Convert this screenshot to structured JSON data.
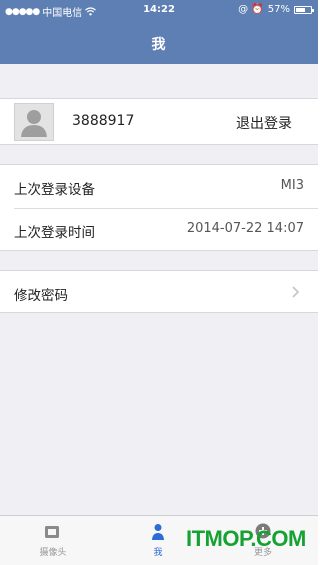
{
  "status_bar": {
    "signal": "●●●●●",
    "carrier": "中国电信",
    "wifi_icon": "wifi-icon",
    "time": "14:22",
    "indicators": "@ ⏰",
    "battery_percent": "57%",
    "battery_level": 0.57
  },
  "header": {
    "title": "我"
  },
  "profile": {
    "avatar_icon": "person-silhouette-icon",
    "username": "3888917",
    "logout_label": "退出登录"
  },
  "device_info": {
    "rows": [
      {
        "label": "上次登录设备",
        "value": "MI3"
      },
      {
        "label": "上次登录时间",
        "value": "2014-07-22 14:07"
      }
    ]
  },
  "password": {
    "label": "修改密码",
    "chevron_icon": "chevron-right-icon"
  },
  "tabbar": {
    "tabs": [
      {
        "label": "摄像头",
        "icon": "camera-icon",
        "active": false
      },
      {
        "label": "我",
        "icon": "person-icon",
        "active": true
      },
      {
        "label": "更多",
        "icon": "plus-circle-icon",
        "active": false
      }
    ]
  },
  "watermark": {
    "text": "ITMOP.COM"
  },
  "colors": {
    "header_bg": "#5e7fb3",
    "page_bg": "#efeff4",
    "active_tab": "#2d6bd6",
    "watermark": "#15a233"
  }
}
